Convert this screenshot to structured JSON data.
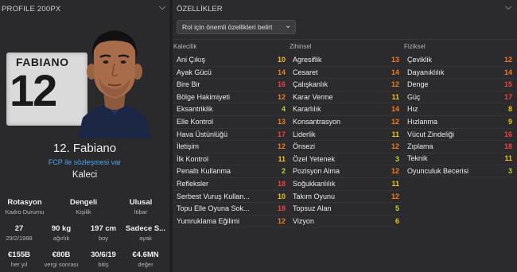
{
  "left_panel": {
    "title": "PROFILE 200PX",
    "card_name": "FABIANO",
    "card_number": "12",
    "player_name": "12. Fabiano",
    "contract": "FCP ile sözleşmesi var",
    "role": "Kaleci",
    "facts": [
      {
        "value": "Rotasyon",
        "label": "Kadro Durumu"
      },
      {
        "value": "Dengeli",
        "label": "Kişilik"
      },
      {
        "value": "Ulusal",
        "label": "İtibar"
      },
      {
        "value": "27",
        "label": "29/2/1988"
      },
      {
        "value": "90 kg",
        "label": "ağırlık"
      },
      {
        "value": "197 cm",
        "label": "boy"
      },
      {
        "value": "Sadece S...",
        "label": "ayak"
      },
      {
        "value": "€155B",
        "label": "her yıl"
      },
      {
        "value": "€80B",
        "label": "vergi sonrası"
      },
      {
        "value": "30/6/19",
        "label": "bitiş"
      },
      {
        "value": "€4.6MN",
        "label": "değer"
      }
    ]
  },
  "right_panel": {
    "title": "ÖZELLİKLER",
    "role_select": "Rol için önemli özellikleri belirt",
    "columns": [
      {
        "header": "Kalecilik",
        "attributes": [
          {
            "name": "Ani Çıkış",
            "value": "10"
          },
          {
            "name": "Ayak Gücü",
            "value": "14"
          },
          {
            "name": "Bire Bir",
            "value": "16"
          },
          {
            "name": "Bölge Hakimiyeti",
            "value": "12"
          },
          {
            "name": "Eksantriklik",
            "value": "4"
          },
          {
            "name": "Elle Kontrol",
            "value": "13"
          },
          {
            "name": "Hava Üstünlüğü",
            "value": "17"
          },
          {
            "name": "İletişim",
            "value": "12"
          },
          {
            "name": "İlk Kontrol",
            "value": "11"
          },
          {
            "name": "Penaltı Kullanma",
            "value": "2"
          },
          {
            "name": "Refleksler",
            "value": "18"
          },
          {
            "name": "Serbest Vuruş Kullan...",
            "value": "10"
          },
          {
            "name": "Topu Elle Oyuna Sok...",
            "value": "18"
          },
          {
            "name": "Yumruklama Eğilimi",
            "value": "12"
          }
        ]
      },
      {
        "header": "Zihinsel",
        "attributes": [
          {
            "name": "Agresiflik",
            "value": "13"
          },
          {
            "name": "Cesaret",
            "value": "14"
          },
          {
            "name": "Çalışkanlık",
            "value": "12"
          },
          {
            "name": "Karar Verme",
            "value": "11"
          },
          {
            "name": "Kararlılık",
            "value": "14"
          },
          {
            "name": "Konsantrasyon",
            "value": "12"
          },
          {
            "name": "Liderlik",
            "value": "11"
          },
          {
            "name": "Önsezi",
            "value": "12"
          },
          {
            "name": "Özel Yetenek",
            "value": "3"
          },
          {
            "name": "Pozisyon Alma",
            "value": "12"
          },
          {
            "name": "Soğukkanlılık",
            "value": "11"
          },
          {
            "name": "Takım Oyunu",
            "value": "12"
          },
          {
            "name": "Topsuz Alan",
            "value": "5"
          },
          {
            "name": "Vizyon",
            "value": "6"
          }
        ]
      },
      {
        "header": "Fiziksel",
        "attributes": [
          {
            "name": "Çeviklik",
            "value": "12"
          },
          {
            "name": "Dayanıklılık",
            "value": "14"
          },
          {
            "name": "Denge",
            "value": "15"
          },
          {
            "name": "Güç",
            "value": "17"
          },
          {
            "name": "Hız",
            "value": "8"
          },
          {
            "name": "Hızlanma",
            "value": "9"
          },
          {
            "name": "Vücut Zindeliği",
            "value": "16"
          },
          {
            "name": "Zıplama",
            "value": "18"
          }
        ]
      },
      {
        "header": "",
        "attributes": [
          {
            "name": "Teknik",
            "value": "11"
          },
          {
            "name": "Oyunculuk Becerisi",
            "value": "3"
          }
        ]
      }
    ]
  },
  "colors": {
    "red": "#f0423c",
    "orange": "#f07c1e",
    "yellow": "#f1c21b",
    "lime": "#b7d434",
    "link": "#46a8ea"
  }
}
